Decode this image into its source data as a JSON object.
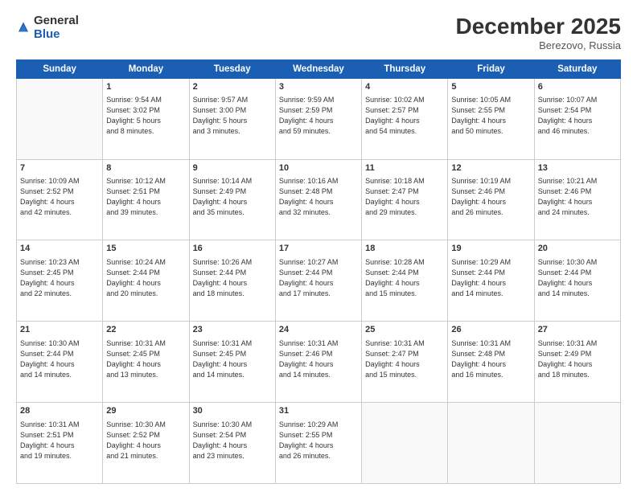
{
  "logo": {
    "general": "General",
    "blue": "Blue"
  },
  "header": {
    "month": "December 2025",
    "location": "Berezovo, Russia"
  },
  "weekdays": [
    "Sunday",
    "Monday",
    "Tuesday",
    "Wednesday",
    "Thursday",
    "Friday",
    "Saturday"
  ],
  "weeks": [
    [
      {
        "num": "",
        "info": ""
      },
      {
        "num": "1",
        "info": "Sunrise: 9:54 AM\nSunset: 3:02 PM\nDaylight: 5 hours\nand 8 minutes."
      },
      {
        "num": "2",
        "info": "Sunrise: 9:57 AM\nSunset: 3:00 PM\nDaylight: 5 hours\nand 3 minutes."
      },
      {
        "num": "3",
        "info": "Sunrise: 9:59 AM\nSunset: 2:59 PM\nDaylight: 4 hours\nand 59 minutes."
      },
      {
        "num": "4",
        "info": "Sunrise: 10:02 AM\nSunset: 2:57 PM\nDaylight: 4 hours\nand 54 minutes."
      },
      {
        "num": "5",
        "info": "Sunrise: 10:05 AM\nSunset: 2:55 PM\nDaylight: 4 hours\nand 50 minutes."
      },
      {
        "num": "6",
        "info": "Sunrise: 10:07 AM\nSunset: 2:54 PM\nDaylight: 4 hours\nand 46 minutes."
      }
    ],
    [
      {
        "num": "7",
        "info": "Sunrise: 10:09 AM\nSunset: 2:52 PM\nDaylight: 4 hours\nand 42 minutes."
      },
      {
        "num": "8",
        "info": "Sunrise: 10:12 AM\nSunset: 2:51 PM\nDaylight: 4 hours\nand 39 minutes."
      },
      {
        "num": "9",
        "info": "Sunrise: 10:14 AM\nSunset: 2:49 PM\nDaylight: 4 hours\nand 35 minutes."
      },
      {
        "num": "10",
        "info": "Sunrise: 10:16 AM\nSunset: 2:48 PM\nDaylight: 4 hours\nand 32 minutes."
      },
      {
        "num": "11",
        "info": "Sunrise: 10:18 AM\nSunset: 2:47 PM\nDaylight: 4 hours\nand 29 minutes."
      },
      {
        "num": "12",
        "info": "Sunrise: 10:19 AM\nSunset: 2:46 PM\nDaylight: 4 hours\nand 26 minutes."
      },
      {
        "num": "13",
        "info": "Sunrise: 10:21 AM\nSunset: 2:46 PM\nDaylight: 4 hours\nand 24 minutes."
      }
    ],
    [
      {
        "num": "14",
        "info": "Sunrise: 10:23 AM\nSunset: 2:45 PM\nDaylight: 4 hours\nand 22 minutes."
      },
      {
        "num": "15",
        "info": "Sunrise: 10:24 AM\nSunset: 2:44 PM\nDaylight: 4 hours\nand 20 minutes."
      },
      {
        "num": "16",
        "info": "Sunrise: 10:26 AM\nSunset: 2:44 PM\nDaylight: 4 hours\nand 18 minutes."
      },
      {
        "num": "17",
        "info": "Sunrise: 10:27 AM\nSunset: 2:44 PM\nDaylight: 4 hours\nand 17 minutes."
      },
      {
        "num": "18",
        "info": "Sunrise: 10:28 AM\nSunset: 2:44 PM\nDaylight: 4 hours\nand 15 minutes."
      },
      {
        "num": "19",
        "info": "Sunrise: 10:29 AM\nSunset: 2:44 PM\nDaylight: 4 hours\nand 14 minutes."
      },
      {
        "num": "20",
        "info": "Sunrise: 10:30 AM\nSunset: 2:44 PM\nDaylight: 4 hours\nand 14 minutes."
      }
    ],
    [
      {
        "num": "21",
        "info": "Sunrise: 10:30 AM\nSunset: 2:44 PM\nDaylight: 4 hours\nand 14 minutes."
      },
      {
        "num": "22",
        "info": "Sunrise: 10:31 AM\nSunset: 2:45 PM\nDaylight: 4 hours\nand 13 minutes."
      },
      {
        "num": "23",
        "info": "Sunrise: 10:31 AM\nSunset: 2:45 PM\nDaylight: 4 hours\nand 14 minutes."
      },
      {
        "num": "24",
        "info": "Sunrise: 10:31 AM\nSunset: 2:46 PM\nDaylight: 4 hours\nand 14 minutes."
      },
      {
        "num": "25",
        "info": "Sunrise: 10:31 AM\nSunset: 2:47 PM\nDaylight: 4 hours\nand 15 minutes."
      },
      {
        "num": "26",
        "info": "Sunrise: 10:31 AM\nSunset: 2:48 PM\nDaylight: 4 hours\nand 16 minutes."
      },
      {
        "num": "27",
        "info": "Sunrise: 10:31 AM\nSunset: 2:49 PM\nDaylight: 4 hours\nand 18 minutes."
      }
    ],
    [
      {
        "num": "28",
        "info": "Sunrise: 10:31 AM\nSunset: 2:51 PM\nDaylight: 4 hours\nand 19 minutes."
      },
      {
        "num": "29",
        "info": "Sunrise: 10:30 AM\nSunset: 2:52 PM\nDaylight: 4 hours\nand 21 minutes."
      },
      {
        "num": "30",
        "info": "Sunrise: 10:30 AM\nSunset: 2:54 PM\nDaylight: 4 hours\nand 23 minutes."
      },
      {
        "num": "31",
        "info": "Sunrise: 10:29 AM\nSunset: 2:55 PM\nDaylight: 4 hours\nand 26 minutes."
      },
      {
        "num": "",
        "info": ""
      },
      {
        "num": "",
        "info": ""
      },
      {
        "num": "",
        "info": ""
      }
    ]
  ]
}
